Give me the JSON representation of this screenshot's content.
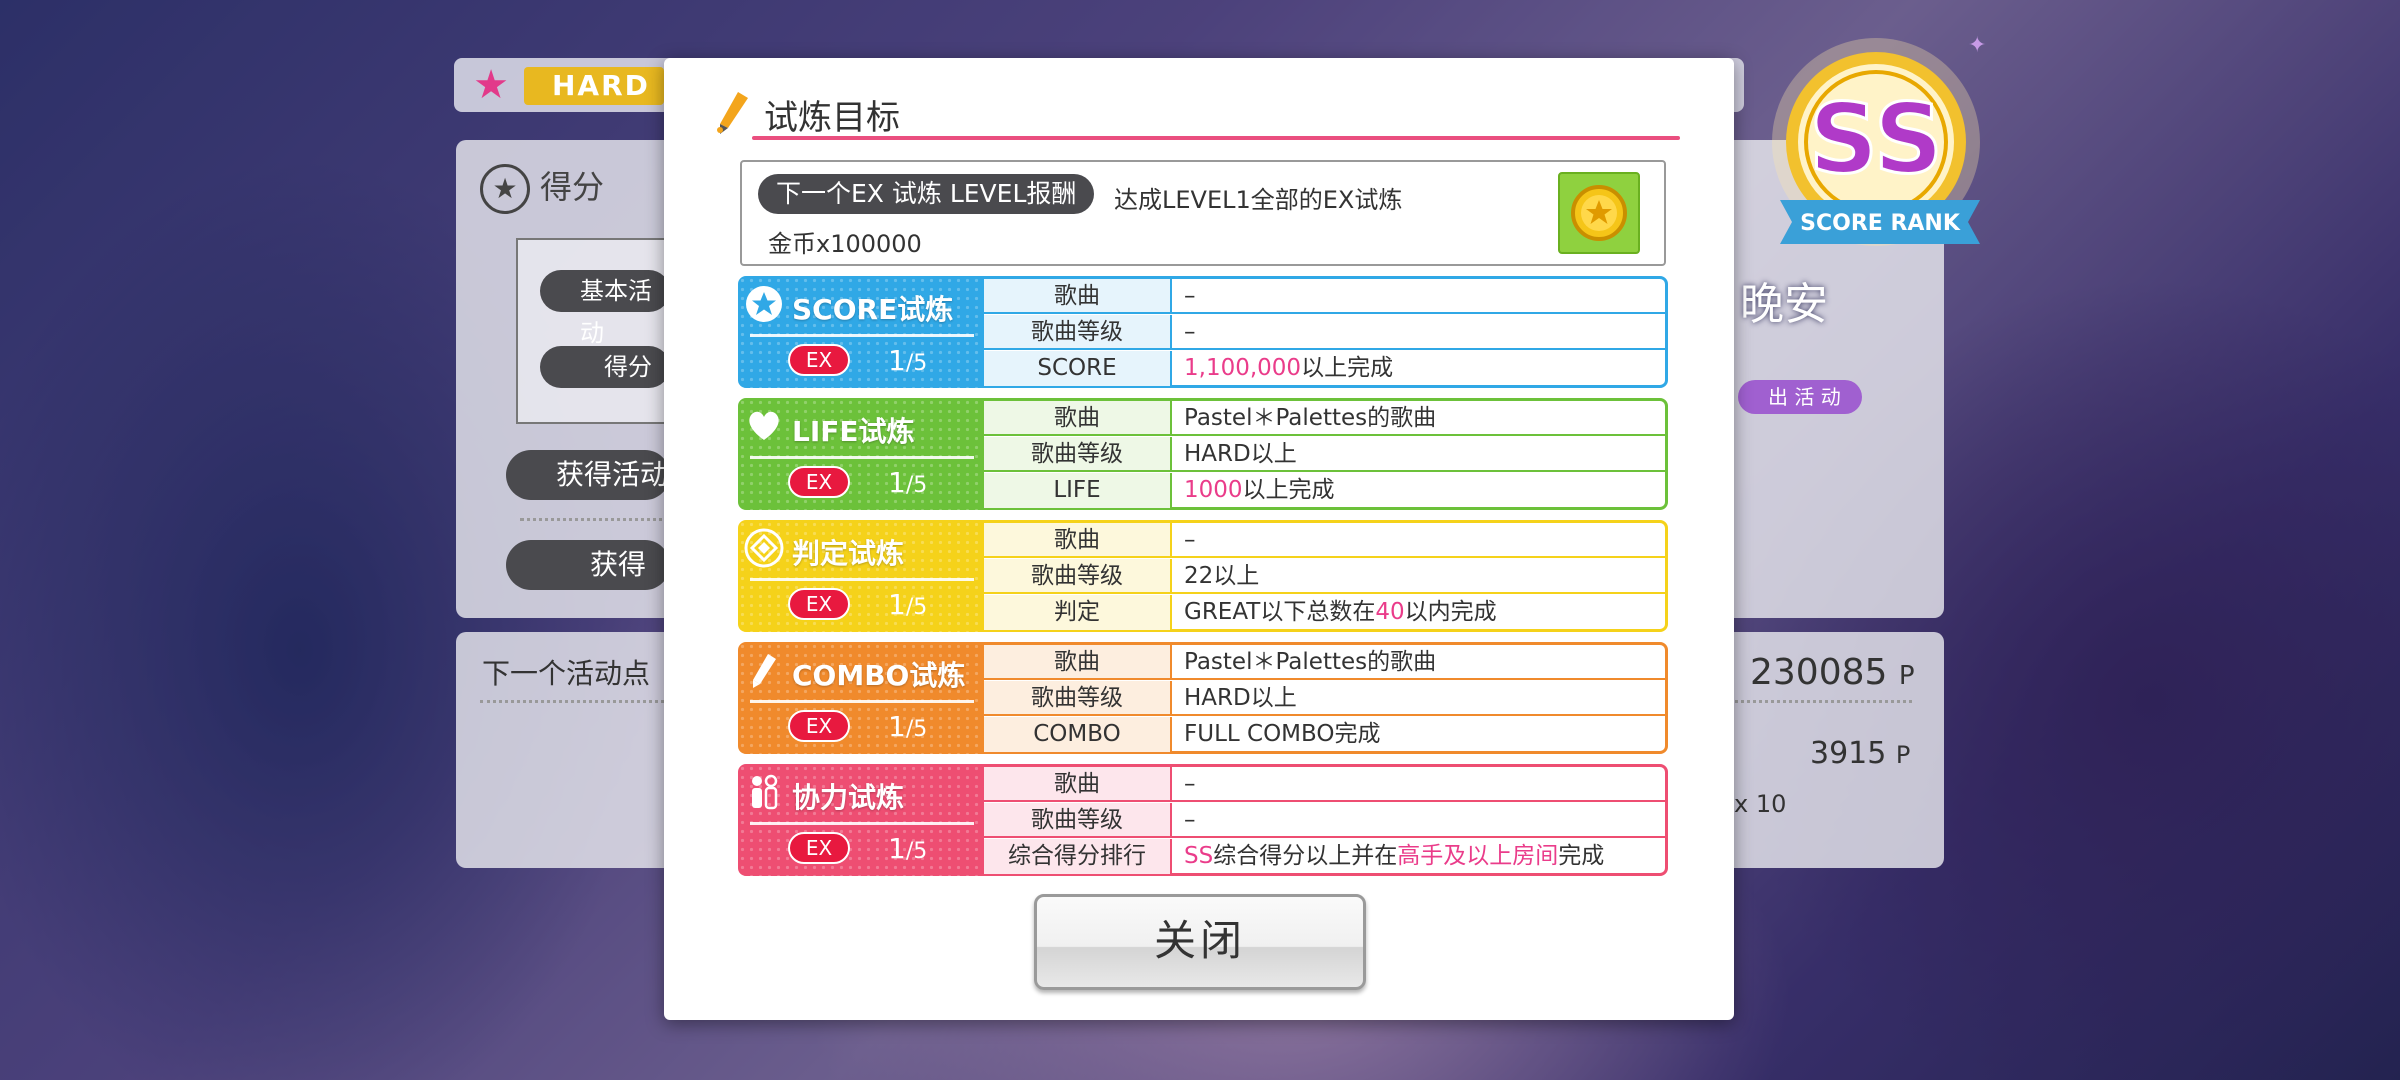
{
  "background": {
    "difficulty": "HARD",
    "score_section_title": "得分",
    "pill_basic_event": "基本活动",
    "pill_score": "得分",
    "pill_get_event": "获得活动",
    "pill_get": "获得",
    "next_event_points_label": "下一个活动点",
    "points_main": "230085",
    "points_unit": "P",
    "points_secondary": "3915",
    "multiplier": "x 10",
    "event_logo_text": "晚安",
    "event_pill_label": "出 活 动",
    "score_rank_grade": "SS",
    "score_rank_label": "SCORE RANK"
  },
  "dialog": {
    "title": "试炼目标",
    "reward": {
      "tag": "下一个EX 试炼 LEVEL报酬",
      "description": "达成LEVEL1全部的EX试炼",
      "amount": "金币x100000"
    },
    "trials": [
      {
        "name": "SCORE试炼",
        "ex_label": "EX",
        "progress_current": "1",
        "progress_total": "/5",
        "color": "#30a8e6",
        "icon": "star-icon",
        "rows": [
          {
            "label": "歌曲",
            "value": "–"
          },
          {
            "label": "歌曲等级",
            "value": "–"
          },
          {
            "label": "SCORE",
            "value_highlight": "1,100,000",
            "value_rest": "以上完成"
          }
        ]
      },
      {
        "name": "LIFE试炼",
        "ex_label": "EX",
        "progress_current": "1",
        "progress_total": "/5",
        "color": "#6cc13a",
        "icon": "heart-icon",
        "rows": [
          {
            "label": "歌曲",
            "value": "Pastel＊Palettes的歌曲"
          },
          {
            "label": "歌曲等级",
            "value": "HARD以上"
          },
          {
            "label": "LIFE",
            "value_highlight": "1000",
            "value_rest": "以上完成"
          }
        ]
      },
      {
        "name": "判定试炼",
        "ex_label": "EX",
        "progress_current": "1",
        "progress_total": "/5",
        "color": "#f5d21a",
        "icon": "judge-diamond-icon",
        "rows": [
          {
            "label": "歌曲",
            "value": "–"
          },
          {
            "label": "歌曲等级",
            "value": "22以上"
          },
          {
            "label": "判定",
            "value_pre": "GREAT以下总数在",
            "value_highlight": "40",
            "value_rest": "以内完成"
          }
        ]
      },
      {
        "name": "COMBO试炼",
        "ex_label": "EX",
        "progress_current": "1",
        "progress_total": "/5",
        "color": "#f08a2c",
        "icon": "pen-icon",
        "rows": [
          {
            "label": "歌曲",
            "value": "Pastel＊Palettes的歌曲"
          },
          {
            "label": "歌曲等级",
            "value": "HARD以上"
          },
          {
            "label": "COMBO",
            "value": "FULL COMBO完成"
          }
        ]
      },
      {
        "name": "协力试炼",
        "ex_label": "EX",
        "progress_current": "1",
        "progress_total": "/5",
        "color": "#ee4e72",
        "icon": "people-icon",
        "rows": [
          {
            "label": "歌曲",
            "value": "–"
          },
          {
            "label": "歌曲等级",
            "value": "–"
          },
          {
            "label": "综合得分排行",
            "value_highlight": "SS",
            "value_mid": "综合得分以上并在",
            "value_highlight2": "高手及以上房间",
            "value_rest": "完成"
          }
        ]
      }
    ],
    "close_label": "关闭"
  }
}
